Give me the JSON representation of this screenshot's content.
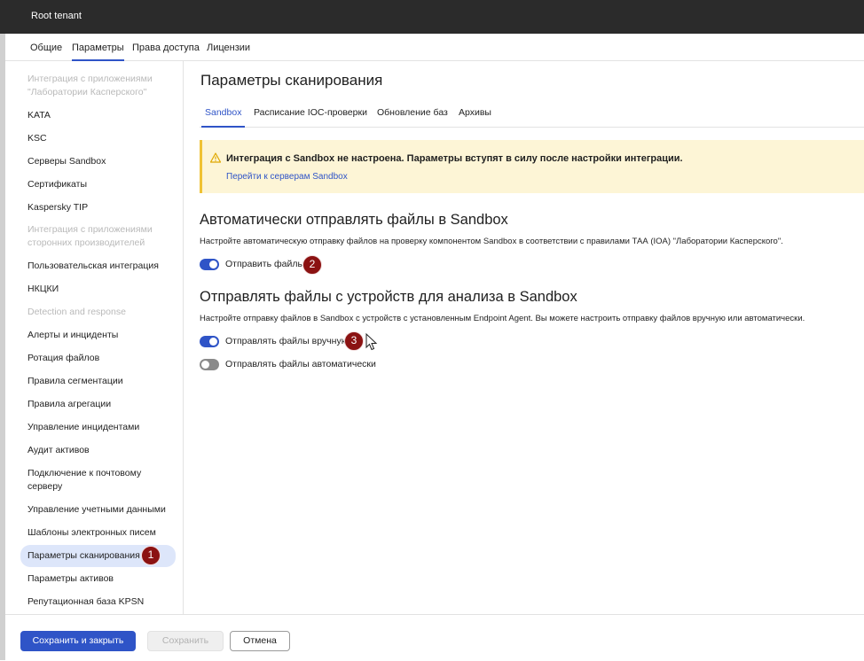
{
  "app": {
    "title": "Root tenant"
  },
  "top_tabs": [
    "Общие",
    "Параметры",
    "Права доступа",
    "Лицензии"
  ],
  "sidebar": {
    "items": [
      {
        "label": "Интеграция с приложениями \"Лаборатории Касперского\"",
        "type": "section"
      },
      {
        "label": "KATA",
        "type": "item"
      },
      {
        "label": "KSC",
        "type": "item"
      },
      {
        "label": "Серверы Sandbox",
        "type": "item"
      },
      {
        "label": "Сертификаты",
        "type": "item"
      },
      {
        "label": "Kaspersky TIP",
        "type": "item"
      },
      {
        "label": "Интеграция с приложениями сторонних производителей",
        "type": "section"
      },
      {
        "label": "Пользовательская интеграция",
        "type": "item"
      },
      {
        "label": "НКЦКИ",
        "type": "item"
      },
      {
        "label": "Detection and response",
        "type": "section"
      },
      {
        "label": "Алерты и инциденты",
        "type": "item"
      },
      {
        "label": "Ротация файлов",
        "type": "item"
      },
      {
        "label": "Правила сегментации",
        "type": "item"
      },
      {
        "label": "Правила агрегации",
        "type": "item"
      },
      {
        "label": "Управление инцидентами",
        "type": "item"
      },
      {
        "label": "Аудит активов",
        "type": "item"
      },
      {
        "label": "Подключение к почтовому серверу",
        "type": "item"
      },
      {
        "label": "Управление учетными данными",
        "type": "item"
      },
      {
        "label": "Шаблоны электронных писем",
        "type": "item"
      },
      {
        "label": "Параметры сканирования",
        "type": "active"
      },
      {
        "label": "Параметры активов",
        "type": "item"
      },
      {
        "label": "Репутационная база KPSN",
        "type": "item"
      }
    ]
  },
  "main": {
    "title": "Параметры сканирования",
    "tabs": [
      "Sandbox",
      "Расписание IOC-проверки",
      "Обновление баз",
      "Архивы"
    ],
    "warning": {
      "text": "Интеграция с Sandbox не настроена. Параметры вступят в силу после настройки интеграции.",
      "link": "Перейти к серверам Sandbox"
    },
    "auto_section": {
      "title": "Автоматически отправлять файлы в Sandbox",
      "description": "Настройте автоматическую отправку файлов на проверку компонентом Sandbox в соответствии с правилами ТАА (IOA) \"Лаборатории Касперского\".",
      "toggle_label": "Отправить файлы"
    },
    "device_section": {
      "title": "Отправлять файлы с устройств для анализа в Sandbox",
      "description": "Настройте отправку файлов в Sandbox с устройств с установленным Endpoint Agent. Вы можете настроить отправку файлов вручную или автоматически.",
      "manual_label": "Отправлять файлы вручную",
      "auto_label": "Отправлять файлы автоматически"
    }
  },
  "callouts": [
    "1",
    "2",
    "3"
  ],
  "footer": {
    "save_close": "Сохранить и закрыть",
    "save": "Сохранить",
    "cancel": "Отмена"
  },
  "colors": {
    "accent": "#2f54c7",
    "warning_bg": "#fdf5d6",
    "warning_border": "#f0c233",
    "callout": "#8b1212"
  }
}
